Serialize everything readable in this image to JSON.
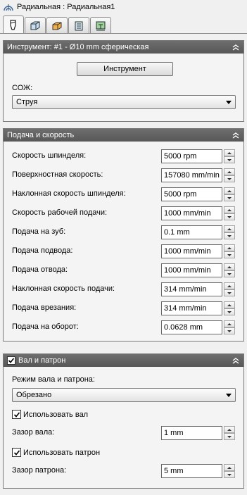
{
  "window": {
    "title": "Радиальная : Радиальная1"
  },
  "tabs": [
    {
      "icon": "tool-icon",
      "active": true
    },
    {
      "icon": "stock-box-icon"
    },
    {
      "icon": "block-icon"
    },
    {
      "icon": "list-icon"
    },
    {
      "icon": "fixture-icon"
    }
  ],
  "tool_panel": {
    "title": "Инструмент: #1 - Ø10 mm сферическая",
    "tool_button": "Инструмент",
    "coolant_label": "СОЖ:",
    "coolant_value": "Струя"
  },
  "feed_panel": {
    "title": "Подача и скорость",
    "rows": [
      {
        "label": "Скорость шпинделя:",
        "value": "5000 rpm"
      },
      {
        "label": "Поверхностная скорость:",
        "value": "157080 mm/min"
      },
      {
        "label": "Наклонная скорость шпинделя:",
        "value": "5000 rpm"
      },
      {
        "label": "Скорость рабочей подачи:",
        "value": "1000 mm/min"
      },
      {
        "label": "Подача на зуб:",
        "value": "0.1 mm"
      },
      {
        "label": "Подача подвода:",
        "value": "1000 mm/min"
      },
      {
        "label": "Подача отвода:",
        "value": "1000 mm/min"
      },
      {
        "label": "Наклонная скорость подачи:",
        "value": "314 mm/min"
      },
      {
        "label": "Подача врезания:",
        "value": "314 mm/min"
      },
      {
        "label": "Подача на оборот:",
        "value": "0.0628 mm"
      }
    ]
  },
  "shaft_panel": {
    "title": "Вал и патрон",
    "enabled": true,
    "mode_label": "Режим вала и патрона:",
    "mode_value": "Обрезано",
    "use_shaft_label": "Использовать вал",
    "shaft_clearance_label": "Зазор вала:",
    "shaft_clearance_value": "1 mm",
    "use_holder_label": "Использовать патрон",
    "holder_clearance_label": "Зазор патрона:",
    "holder_clearance_value": "5 mm"
  }
}
